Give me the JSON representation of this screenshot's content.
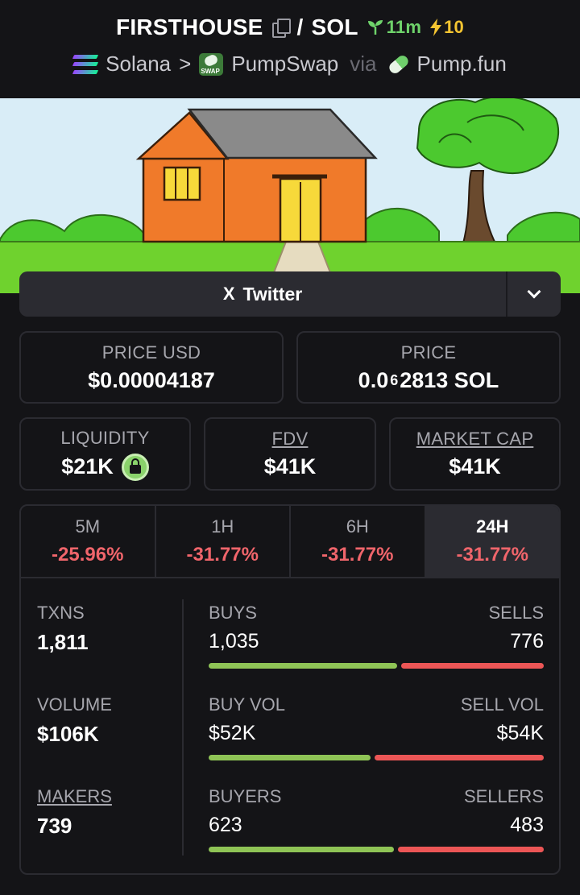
{
  "header": {
    "token": "FIRSTHOUSE",
    "separator": "/",
    "quote": "SOL",
    "age": "11m",
    "boosts": "10",
    "chain": "Solana",
    "crumb_sep": ">",
    "dex": "PumpSwap",
    "via": "via",
    "launchpad": "Pump.fun",
    "icons": {
      "copy": "copy-icon",
      "age": "sprout-icon",
      "boost": "lightning-icon",
      "chain": "solana-logo",
      "dex": "pumpswap-logo",
      "launchpad": "pumpfun-logo"
    }
  },
  "colors": {
    "positive": "#8fc456",
    "negative": "#ec5656",
    "age": "#6fd36b",
    "boost": "#f5c531"
  },
  "social": {
    "twitter_icon": "X",
    "twitter_label": "Twitter"
  },
  "price": {
    "usd_label": "PRICE USD",
    "usd_value": "$0.00004187",
    "native_label": "PRICE",
    "native_prefix": "0.0",
    "native_zeros": "6",
    "native_suffix": "2813 SOL"
  },
  "metrics_top": {
    "liquidity_label": "LIQUIDITY",
    "liquidity_value": "$21K",
    "fdv_label": "FDV",
    "fdv_value": "$41K",
    "mcap_label": "MARKET CAP",
    "mcap_value": "$41K"
  },
  "timeframes": [
    {
      "label": "5M",
      "change": "-25.96%"
    },
    {
      "label": "1H",
      "change": "-31.77%"
    },
    {
      "label": "6H",
      "change": "-31.77%"
    },
    {
      "label": "24H",
      "change": "-31.77%"
    }
  ],
  "active_timeframe": "24H",
  "stats": {
    "txns": {
      "label": "TXNS",
      "value": "1,811",
      "left_label": "BUYS",
      "left_value": "1,035",
      "right_label": "SELLS",
      "right_value": "776",
      "buy_share": 0.57
    },
    "volume": {
      "label": "VOLUME",
      "value": "$106K",
      "left_label": "BUY VOL",
      "left_value": "$52K",
      "right_label": "SELL VOL",
      "right_value": "$54K",
      "buy_share": 0.49
    },
    "makers": {
      "label": "MAKERS",
      "value": "739",
      "left_label": "BUYERS",
      "left_value": "623",
      "right_label": "SELLERS",
      "right_value": "483",
      "buy_share": 0.56
    }
  }
}
